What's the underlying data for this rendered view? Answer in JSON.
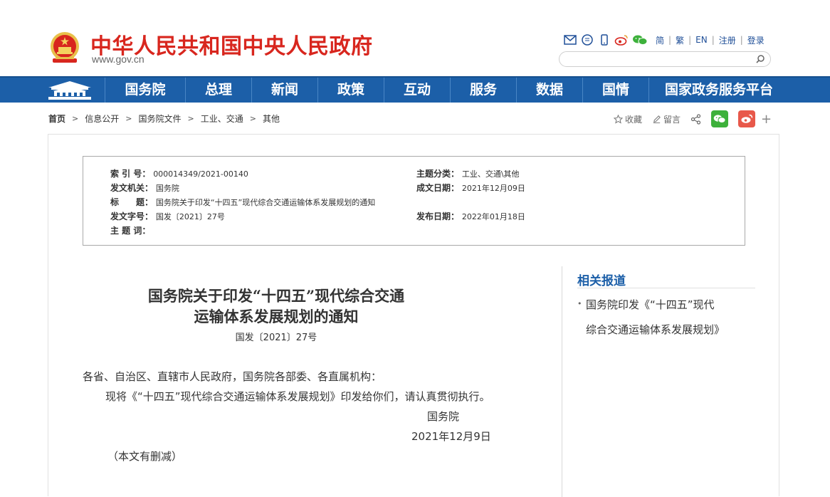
{
  "header": {
    "site_title": "中华人民共和国中央人民政府",
    "site_url": "www.gov.cn",
    "lang_links": [
      "简",
      "繁",
      "EN"
    ],
    "register": "注册",
    "login": "登录",
    "search_placeholder": ""
  },
  "nav": {
    "items": [
      "国务院",
      "总理",
      "新闻",
      "政策",
      "互动",
      "服务",
      "数据",
      "国情",
      "国家政务服务平台"
    ]
  },
  "breadcrumb": [
    "首页",
    "信息公开",
    "国务院文件",
    "工业、交通",
    "其他"
  ],
  "page_tools": {
    "favorite": "收藏",
    "comment": "留言"
  },
  "meta": {
    "index_label": "索 引 号：",
    "index_value": "000014349/2021-00140",
    "category_label": "主题分类：",
    "category_value": "工业、交通\\其他",
    "issuer_label": "发文机关：",
    "issuer_value": "国务院",
    "date_written_label": "成文日期：",
    "date_written_value": "2021年12月09日",
    "title_label": "标　　题：",
    "title_value": "国务院关于印发“十四五”现代综合交通运输体系发展规划的通知",
    "doc_no_label": "发文字号：",
    "doc_no_value": "国发〔2021〕27号",
    "pub_date_label": "发布日期：",
    "pub_date_value": "2022年01月18日",
    "keywords_label": "主 题 词：",
    "keywords_value": ""
  },
  "article": {
    "title_line1": "国务院关于印发“十四五”现代综合交通",
    "title_line2": "运输体系发展规划的通知",
    "doc_number": "国发〔2021〕27号",
    "salutation": "各省、自治区、直辖市人民政府，国务院各部委、各直属机构：",
    "body": "现将《“十四五”现代综合交通运输体系发展规划》印发给你们，请认真贯彻执行。",
    "signature": "国务院",
    "date": "2021年12月9日",
    "note": "（本文有删减）"
  },
  "related": {
    "title": "相关报道",
    "item_line1": "国务院印发《“十四五”现代",
    "item_line2": "综合交通运输体系发展规划》"
  },
  "colors": {
    "brand_red": "#d8261e",
    "nav_blue": "#1c5fa8",
    "wechat_green": "#3db13b",
    "weibo_red": "#e8584a"
  }
}
